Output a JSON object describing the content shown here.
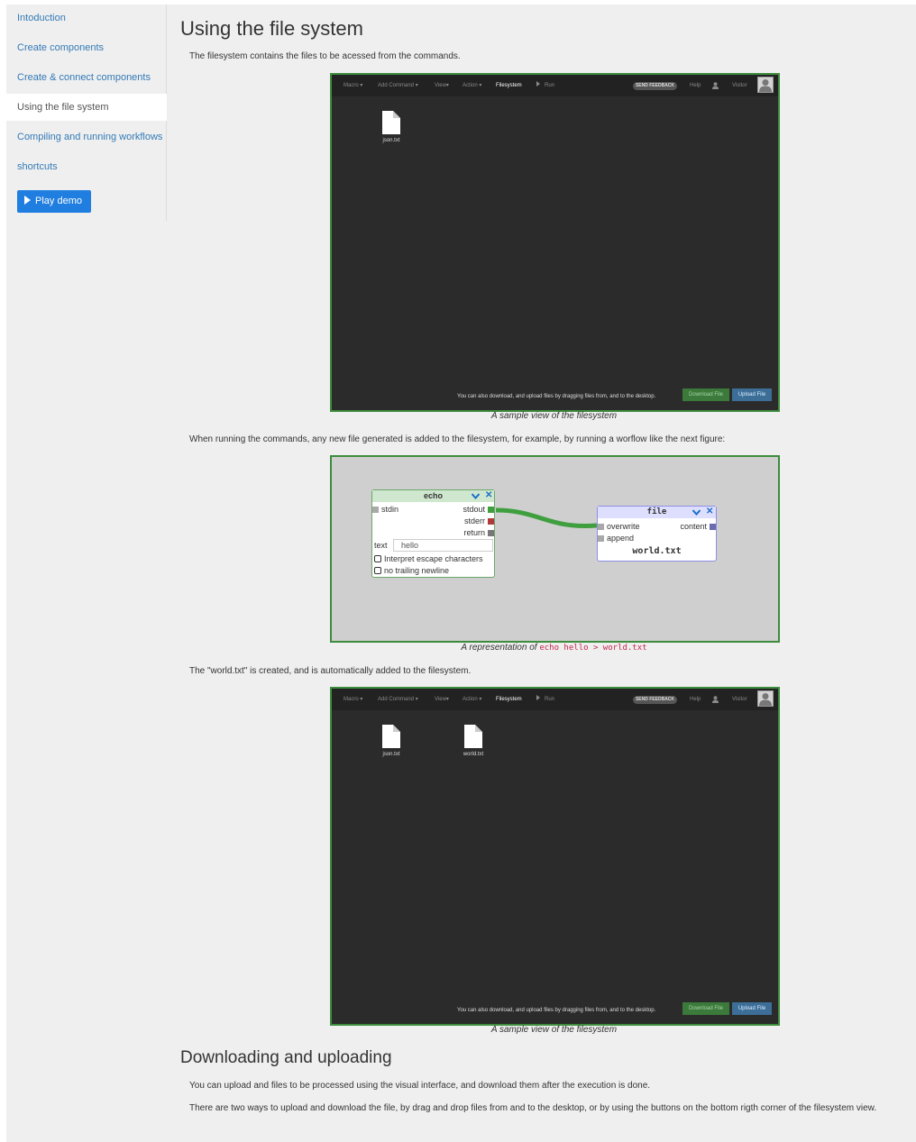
{
  "sidebar": {
    "items": [
      {
        "label": "Intoduction",
        "active": false
      },
      {
        "label": "Create components",
        "active": false
      },
      {
        "label": "Create & connect components",
        "active": false
      },
      {
        "label": "Using the file system",
        "active": true
      },
      {
        "label": "Compiling and running workflows",
        "active": false
      },
      {
        "label": "shortcuts",
        "active": false
      }
    ],
    "play_button": "Play demo"
  },
  "main": {
    "title": "Using the file system",
    "intro": "The filesystem contains the files to be acessed from the commands.",
    "caption_fs": "A sample view of the filesystem",
    "running_text": "When running the commands, any new file generated is added to the filesystem, for example, by running a worflow like the next figure:",
    "caption_wf_prefix": "A representation of",
    "caption_wf_code": "echo hello > world.txt",
    "created_text": "The \"world.txt\" is created, and is automatically added to the filesystem.",
    "caption_fs2": "A sample view of the filesystem",
    "subtitle": "Downloading and uploading",
    "upload_text": "You can upload and files to be processed using the visual interface, and download them after the execution is done.",
    "ways_text": "There are two ways to upload and download the file, by drag and drop files from and to the desktop, or by using the buttons on the bottom rigth corner of the filesystem view."
  },
  "fs_app": {
    "menu": [
      "Macro",
      "Add Command",
      "View",
      "Action",
      "Filesystem",
      "Run"
    ],
    "active_menu": "Filesystem",
    "send_feedback": "SEND FEEDBACK",
    "help": "Help",
    "visitor": "Visitor",
    "hint": "You can also download, and upload files by dragging files from, and to the desktop.",
    "download_button": "Download File",
    "upload_button": "Upload File"
  },
  "fs1_files": [
    "json.txt"
  ],
  "fs2_files": [
    "json.txt",
    "world.txt"
  ],
  "workflow": {
    "echo": {
      "title": "echo",
      "stdin": "stdin",
      "stdout": "stdout",
      "stderr": "stderr",
      "return": "return",
      "text_label": "text",
      "text_value": "hello",
      "opt1": "Interpret escape characters",
      "opt2": "no trailing newline"
    },
    "file": {
      "title": "file",
      "overwrite": "overwrite",
      "append": "append",
      "content": "content",
      "filename": "world.txt"
    }
  },
  "colors": {
    "link": "#337ab7",
    "play_button": "#1f7ee0",
    "frame_border": "#3d8c3d",
    "stdout_port": "#3f9f3f",
    "stderr_port": "#b03a3a"
  }
}
